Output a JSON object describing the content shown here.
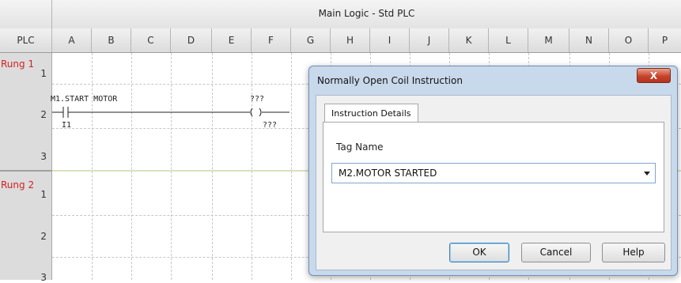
{
  "editor": {
    "title": "Main Logic - Std PLC",
    "corner_label": "PLC",
    "columns": [
      "A",
      "B",
      "C",
      "D",
      "E",
      "F",
      "G",
      "H",
      "I",
      "J",
      "K",
      "L",
      "M",
      "N",
      "O",
      "P"
    ],
    "rungs": [
      {
        "label": "Rung 1",
        "rows": [
          "1",
          "2",
          "3"
        ]
      },
      {
        "label": "Rung 2",
        "rows": [
          "1",
          "2",
          "3"
        ]
      }
    ],
    "contact": {
      "tag": "M1.START MOTOR",
      "address": "I1"
    },
    "coil": {
      "tag_top": "???",
      "tag_bottom": "???",
      "symbol": "( )"
    }
  },
  "dialog": {
    "title": "Normally Open Coil Instruction",
    "close_label": "X",
    "tab_label": "Instruction Details",
    "field_label": "Tag Name",
    "field_value": "M2.MOTOR STARTED",
    "ok_label": "OK",
    "cancel_label": "Cancel",
    "help_label": "Help"
  },
  "colors": {
    "rung_label": "#d42020",
    "dialog_frame": "#c9d9ec",
    "close_button": "#c7442b"
  }
}
